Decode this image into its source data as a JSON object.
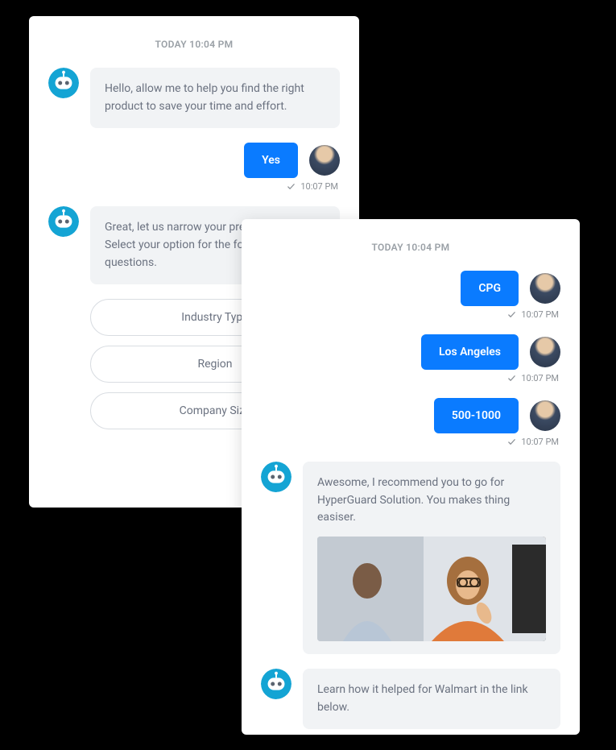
{
  "left": {
    "timestamp": "TODAY 10:04 PM",
    "bot1": "Hello, allow me to help you find the right product to save your time and effort.",
    "user1": "Yes",
    "user1_time": "10:07 PM",
    "bot2_line1": "Great, let us narrow your preference.",
    "bot2_line2": "Select your option for the following questions.",
    "options": {
      "industry": "Industry Type",
      "region": "Region",
      "company_size": "Company Size"
    }
  },
  "right": {
    "timestamp": "TODAY 10:04 PM",
    "user1": "CPG",
    "user1_time": "10:07 PM",
    "user2": "Los Angeles",
    "user2_time": "10:07 PM",
    "user3": "500-1000",
    "user3_time": "10:07 PM",
    "bot1": "Awesome, I recommend you to go for HyperGuard Solution. You makes thing easiser.",
    "bot2": "Learn how it helped for Walmart in the link below."
  }
}
